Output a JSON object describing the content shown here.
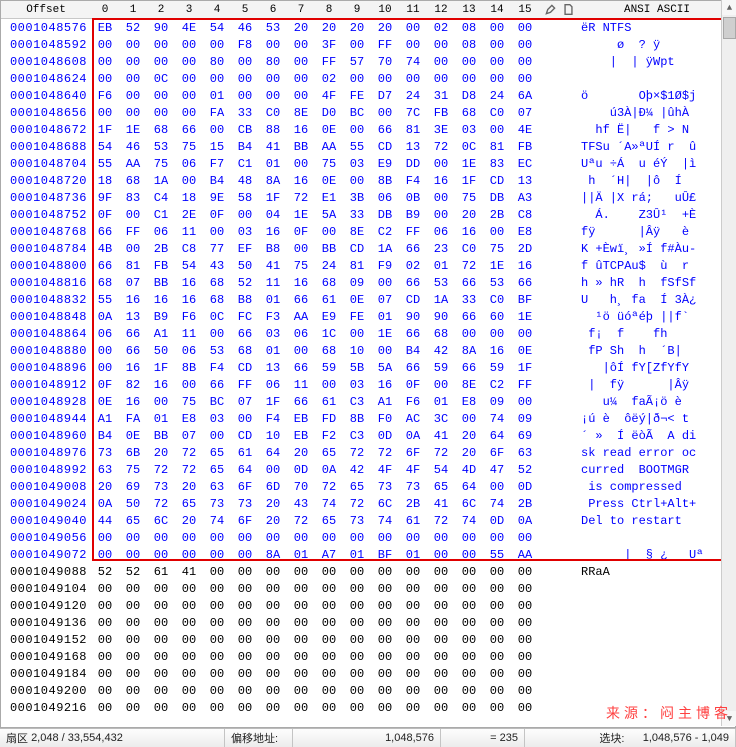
{
  "header": {
    "offset_label": "Offset",
    "columns": [
      "0",
      "1",
      "2",
      "3",
      "4",
      "5",
      "6",
      "7",
      "8",
      "9",
      "10",
      "11",
      "12",
      "13",
      "14",
      "15"
    ],
    "encoding_label": "ANSI ASCII"
  },
  "highlight": {
    "start_row": 0,
    "rows": 32
  },
  "rows": [
    {
      "off": "0001048576",
      "hex": [
        "EB",
        "52",
        "90",
        "4E",
        "54",
        "46",
        "53",
        "20",
        "20",
        "20",
        "20",
        "00",
        "02",
        "08",
        "00",
        "00"
      ],
      "ascii": "ëR NTFS         ",
      "hl": true
    },
    {
      "off": "0001048592",
      "hex": [
        "00",
        "00",
        "00",
        "00",
        "00",
        "F8",
        "00",
        "00",
        "3F",
        "00",
        "FF",
        "00",
        "00",
        "08",
        "00",
        "00"
      ],
      "ascii": "     ø  ? ÿ     ",
      "hl": true
    },
    {
      "off": "0001048608",
      "hex": [
        "00",
        "00",
        "00",
        "00",
        "80",
        "00",
        "80",
        "00",
        "FF",
        "57",
        "70",
        "74",
        "00",
        "00",
        "00",
        "00"
      ],
      "ascii": "    |  | ÿWpt    ",
      "hl": true
    },
    {
      "off": "0001048624",
      "hex": [
        "00",
        "00",
        "0C",
        "00",
        "00",
        "00",
        "00",
        "00",
        "02",
        "00",
        "00",
        "00",
        "00",
        "00",
        "00",
        "00"
      ],
      "ascii": "                ",
      "hl": true
    },
    {
      "off": "0001048640",
      "hex": [
        "F6",
        "00",
        "00",
        "00",
        "01",
        "00",
        "00",
        "00",
        "4F",
        "FE",
        "D7",
        "24",
        "31",
        "D8",
        "24",
        "6A"
      ],
      "ascii": "ö       Oþ×$1Ø$j",
      "hl": true
    },
    {
      "off": "0001048656",
      "hex": [
        "00",
        "00",
        "00",
        "00",
        "FA",
        "33",
        "C0",
        "8E",
        "D0",
        "BC",
        "00",
        "7C",
        "FB",
        "68",
        "C0",
        "07"
      ],
      "ascii": "    ú3À|Ð¼ |ûhÀ ",
      "hl": true
    },
    {
      "off": "0001048672",
      "hex": [
        "1F",
        "1E",
        "68",
        "66",
        "00",
        "CB",
        "88",
        "16",
        "0E",
        "00",
        "66",
        "81",
        "3E",
        "03",
        "00",
        "4E"
      ],
      "ascii": "  hf Ë|   f > N",
      "hl": true
    },
    {
      "off": "0001048688",
      "hex": [
        "54",
        "46",
        "53",
        "75",
        "15",
        "B4",
        "41",
        "BB",
        "AA",
        "55",
        "CD",
        "13",
        "72",
        "0C",
        "81",
        "FB"
      ],
      "ascii": "TFSu ´A»ªUÍ r  û",
      "hl": true
    },
    {
      "off": "0001048704",
      "hex": [
        "55",
        "AA",
        "75",
        "06",
        "F7",
        "C1",
        "01",
        "00",
        "75",
        "03",
        "E9",
        "DD",
        "00",
        "1E",
        "83",
        "EC"
      ],
      "ascii": "Uªu ÷Á  u éÝ  |ì",
      "hl": true
    },
    {
      "off": "0001048720",
      "hex": [
        "18",
        "68",
        "1A",
        "00",
        "B4",
        "48",
        "8A",
        "16",
        "0E",
        "00",
        "8B",
        "F4",
        "16",
        "1F",
        "CD",
        "13"
      ],
      "ascii": " h  ´H|  |ô  Í ",
      "hl": true
    },
    {
      "off": "0001048736",
      "hex": [
        "9F",
        "83",
        "C4",
        "18",
        "9E",
        "58",
        "1F",
        "72",
        "E1",
        "3B",
        "06",
        "0B",
        "00",
        "75",
        "DB",
        "A3"
      ],
      "ascii": "||Ä |X rá;   uÛ£",
      "hl": true
    },
    {
      "off": "0001048752",
      "hex": [
        "0F",
        "00",
        "C1",
        "2E",
        "0F",
        "00",
        "04",
        "1E",
        "5A",
        "33",
        "DB",
        "B9",
        "00",
        "20",
        "2B",
        "C8"
      ],
      "ascii": "  Á.    Z3Û¹  +È",
      "hl": true
    },
    {
      "off": "0001048768",
      "hex": [
        "66",
        "FF",
        "06",
        "11",
        "00",
        "03",
        "16",
        "0F",
        "00",
        "8E",
        "C2",
        "FF",
        "06",
        "16",
        "00",
        "E8"
      ],
      "ascii": "fÿ      |Âÿ   è",
      "hl": true
    },
    {
      "off": "0001048784",
      "hex": [
        "4B",
        "00",
        "2B",
        "C8",
        "77",
        "EF",
        "B8",
        "00",
        "BB",
        "CD",
        "1A",
        "66",
        "23",
        "C0",
        "75",
        "2D"
      ],
      "ascii": "K +Èwï¸ »Í f#Àu-",
      "hl": true
    },
    {
      "off": "0001048800",
      "hex": [
        "66",
        "81",
        "FB",
        "54",
        "43",
        "50",
        "41",
        "75",
        "24",
        "81",
        "F9",
        "02",
        "01",
        "72",
        "1E",
        "16"
      ],
      "ascii": "f ûTCPAu$  ù  r ",
      "hl": true
    },
    {
      "off": "0001048816",
      "hex": [
        "68",
        "07",
        "BB",
        "16",
        "68",
        "52",
        "11",
        "16",
        "68",
        "09",
        "00",
        "66",
        "53",
        "66",
        "53",
        "66"
      ],
      "ascii": "h » hR  h  fSfSf",
      "hl": true
    },
    {
      "off": "0001048832",
      "hex": [
        "55",
        "16",
        "16",
        "16",
        "68",
        "B8",
        "01",
        "66",
        "61",
        "0E",
        "07",
        "CD",
        "1A",
        "33",
        "C0",
        "BF"
      ],
      "ascii": "U   h¸ fa  Í 3À¿",
      "hl": true
    },
    {
      "off": "0001048848",
      "hex": [
        "0A",
        "13",
        "B9",
        "F6",
        "0C",
        "FC",
        "F3",
        "AA",
        "E9",
        "FE",
        "01",
        "90",
        "90",
        "66",
        "60",
        "1E"
      ],
      "ascii": "  ¹ö üóªéþ ||f` ",
      "hl": true
    },
    {
      "off": "0001048864",
      "hex": [
        "06",
        "66",
        "A1",
        "11",
        "00",
        "66",
        "03",
        "06",
        "1C",
        "00",
        "1E",
        "66",
        "68",
        "00",
        "00",
        "00"
      ],
      "ascii": " f¡  f    fh    ",
      "hl": true
    },
    {
      "off": "0001048880",
      "hex": [
        "00",
        "66",
        "50",
        "06",
        "53",
        "68",
        "01",
        "00",
        "68",
        "10",
        "00",
        "B4",
        "42",
        "8A",
        "16",
        "0E"
      ],
      "ascii": " fP Sh  h  ´B|  ",
      "hl": true
    },
    {
      "off": "0001048896",
      "hex": [
        "00",
        "16",
        "1F",
        "8B",
        "F4",
        "CD",
        "13",
        "66",
        "59",
        "5B",
        "5A",
        "66",
        "59",
        "66",
        "59",
        "1F"
      ],
      "ascii": "   |ôÍ fY[ZfYfY ",
      "hl": true
    },
    {
      "off": "0001048912",
      "hex": [
        "0F",
        "82",
        "16",
        "00",
        "66",
        "FF",
        "06",
        "11",
        "00",
        "03",
        "16",
        "0F",
        "00",
        "8E",
        "C2",
        "FF"
      ],
      "ascii": " |  fÿ      |Âÿ",
      "hl": true
    },
    {
      "off": "0001048928",
      "hex": [
        "0E",
        "16",
        "00",
        "75",
        "BC",
        "07",
        "1F",
        "66",
        "61",
        "C3",
        "A1",
        "F6",
        "01",
        "E8",
        "09",
        "00"
      ],
      "ascii": "   u¼  faÃ¡ö è  ",
      "hl": true
    },
    {
      "off": "0001048944",
      "hex": [
        "A1",
        "FA",
        "01",
        "E8",
        "03",
        "00",
        "F4",
        "EB",
        "FD",
        "8B",
        "F0",
        "AC",
        "3C",
        "00",
        "74",
        "09"
      ],
      "ascii": "¡ú è  ôëý|ð¬< t ",
      "hl": true
    },
    {
      "off": "0001048960",
      "hex": [
        "B4",
        "0E",
        "BB",
        "07",
        "00",
        "CD",
        "10",
        "EB",
        "F2",
        "C3",
        "0D",
        "0A",
        "41",
        "20",
        "64",
        "69"
      ],
      "ascii": "´ »  Í ëòÃ  A di",
      "hl": true
    },
    {
      "off": "0001048976",
      "hex": [
        "73",
        "6B",
        "20",
        "72",
        "65",
        "61",
        "64",
        "20",
        "65",
        "72",
        "72",
        "6F",
        "72",
        "20",
        "6F",
        "63"
      ],
      "ascii": "sk read error oc",
      "hl": true
    },
    {
      "off": "0001048992",
      "hex": [
        "63",
        "75",
        "72",
        "72",
        "65",
        "64",
        "00",
        "0D",
        "0A",
        "42",
        "4F",
        "4F",
        "54",
        "4D",
        "47",
        "52"
      ],
      "ascii": "curred  BOOTMGR",
      "hl": true
    },
    {
      "off": "0001049008",
      "hex": [
        "20",
        "69",
        "73",
        "20",
        "63",
        "6F",
        "6D",
        "70",
        "72",
        "65",
        "73",
        "73",
        "65",
        "64",
        "00",
        "0D"
      ],
      "ascii": " is compressed  ",
      "hl": true
    },
    {
      "off": "0001049024",
      "hex": [
        "0A",
        "50",
        "72",
        "65",
        "73",
        "73",
        "20",
        "43",
        "74",
        "72",
        "6C",
        "2B",
        "41",
        "6C",
        "74",
        "2B"
      ],
      "ascii": " Press Ctrl+Alt+",
      "hl": true
    },
    {
      "off": "0001049040",
      "hex": [
        "44",
        "65",
        "6C",
        "20",
        "74",
        "6F",
        "20",
        "72",
        "65",
        "73",
        "74",
        "61",
        "72",
        "74",
        "0D",
        "0A"
      ],
      "ascii": "Del to restart  ",
      "hl": true
    },
    {
      "off": "0001049056",
      "hex": [
        "00",
        "00",
        "00",
        "00",
        "00",
        "00",
        "00",
        "00",
        "00",
        "00",
        "00",
        "00",
        "00",
        "00",
        "00",
        "00"
      ],
      "ascii": "                ",
      "hl": true
    },
    {
      "off": "0001049072",
      "hex": [
        "00",
        "00",
        "00",
        "00",
        "00",
        "00",
        "8A",
        "01",
        "A7",
        "01",
        "BF",
        "01",
        "00",
        "00",
        "55",
        "AA"
      ],
      "ascii": "      |  § ¿   Uª",
      "hl": true
    },
    {
      "off": "0001049088",
      "hex": [
        "52",
        "52",
        "61",
        "41",
        "00",
        "00",
        "00",
        "00",
        "00",
        "00",
        "00",
        "00",
        "00",
        "00",
        "00",
        "00"
      ],
      "ascii": "RRaA            ",
      "hl": false
    },
    {
      "off": "0001049104",
      "hex": [
        "00",
        "00",
        "00",
        "00",
        "00",
        "00",
        "00",
        "00",
        "00",
        "00",
        "00",
        "00",
        "00",
        "00",
        "00",
        "00"
      ],
      "ascii": "                ",
      "hl": false
    },
    {
      "off": "0001049120",
      "hex": [
        "00",
        "00",
        "00",
        "00",
        "00",
        "00",
        "00",
        "00",
        "00",
        "00",
        "00",
        "00",
        "00",
        "00",
        "00",
        "00"
      ],
      "ascii": "                ",
      "hl": false
    },
    {
      "off": "0001049136",
      "hex": [
        "00",
        "00",
        "00",
        "00",
        "00",
        "00",
        "00",
        "00",
        "00",
        "00",
        "00",
        "00",
        "00",
        "00",
        "00",
        "00"
      ],
      "ascii": "                ",
      "hl": false
    },
    {
      "off": "0001049152",
      "hex": [
        "00",
        "00",
        "00",
        "00",
        "00",
        "00",
        "00",
        "00",
        "00",
        "00",
        "00",
        "00",
        "00",
        "00",
        "00",
        "00"
      ],
      "ascii": "                ",
      "hl": false
    },
    {
      "off": "0001049168",
      "hex": [
        "00",
        "00",
        "00",
        "00",
        "00",
        "00",
        "00",
        "00",
        "00",
        "00",
        "00",
        "00",
        "00",
        "00",
        "00",
        "00"
      ],
      "ascii": "                ",
      "hl": false
    },
    {
      "off": "0001049184",
      "hex": [
        "00",
        "00",
        "00",
        "00",
        "00",
        "00",
        "00",
        "00",
        "00",
        "00",
        "00",
        "00",
        "00",
        "00",
        "00",
        "00"
      ],
      "ascii": "                ",
      "hl": false
    },
    {
      "off": "0001049200",
      "hex": [
        "00",
        "00",
        "00",
        "00",
        "00",
        "00",
        "00",
        "00",
        "00",
        "00",
        "00",
        "00",
        "00",
        "00",
        "00",
        "00"
      ],
      "ascii": "                ",
      "hl": false
    },
    {
      "off": "0001049216",
      "hex": [
        "00",
        "00",
        "00",
        "00",
        "00",
        "00",
        "00",
        "00",
        "00",
        "00",
        "00",
        "00",
        "00",
        "00",
        "00",
        "00"
      ],
      "ascii": "                ",
      "hl": false
    }
  ],
  "watermark": "来源：闷主博客",
  "status": {
    "sector_prefix": "扇区",
    "sector": "2,048 / 33,554,432",
    "offset_label": "偏移地址:",
    "offset_value": "1,048,576",
    "eq_label": "= 235",
    "sel_label": "选块:",
    "sel_value": "1,048,576 - 1,049"
  }
}
